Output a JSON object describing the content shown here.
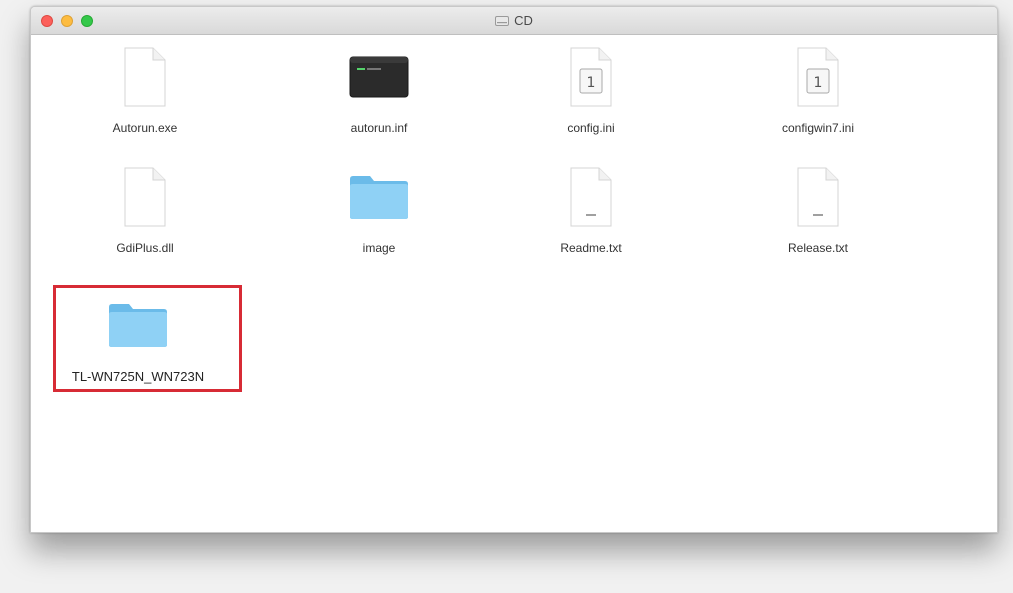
{
  "window": {
    "title": "CD"
  },
  "files": [
    {
      "name": "Autorun.exe",
      "icon": "blank-document-icon"
    },
    {
      "name": "autorun.inf",
      "icon": "terminal-executable-icon"
    },
    {
      "name": "config.ini",
      "icon": "ini-document-icon"
    },
    {
      "name": "configwin7.ini",
      "icon": "ini-document-icon"
    },
    {
      "name": "GdiPlus.dll",
      "icon": "blank-document-icon"
    },
    {
      "name": "image",
      "icon": "folder-icon"
    },
    {
      "name": "Readme.txt",
      "icon": "text-document-icon"
    },
    {
      "name": "Release.txt",
      "icon": "text-document-icon"
    },
    {
      "name": "TL-WN725N_WN723N",
      "icon": "folder-icon"
    }
  ],
  "colors": {
    "folder": "#7cc8f2",
    "highlight": "#d72b35"
  }
}
